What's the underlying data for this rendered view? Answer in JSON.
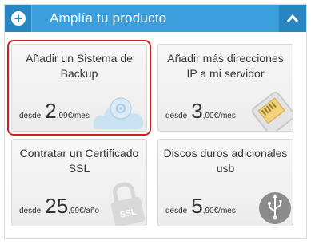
{
  "header": {
    "title": "Amplía tu producto",
    "expand_icon": "plus-circle-icon",
    "collapse_icon": "chevron-up-icon"
  },
  "colors": {
    "header_bg": "#3b9fdc",
    "header_dark": "#2a86c1",
    "selected_outline": "#cf1f1f"
  },
  "cards": [
    {
      "title_line1": "Añadir un Sistema de",
      "title_line2": "Backup",
      "from": "desde",
      "price_int": "2",
      "price_dec": ",99",
      "unit": " €/mes",
      "icon": "cloud-backup-icon",
      "selected": true
    },
    {
      "title_line1": "Añadir más direcciones",
      "title_line2": "IP a mi servidor",
      "from": "desde",
      "price_int": "3",
      "price_dec": ",00",
      "unit": " €/mes",
      "icon": "ethernet-port-icon",
      "selected": false
    },
    {
      "title_line1": "Contratar un Certificado",
      "title_line2": "SSL",
      "from": "desde",
      "price_int": "25",
      "price_dec": ",99",
      "unit": " €/año",
      "icon": "ssl-lock-icon",
      "icon_text": "SSL",
      "selected": false
    },
    {
      "title_line1": "Discos duros adicionales",
      "title_line2": "usb",
      "from": "desde",
      "price_int": "5",
      "price_dec": ",90",
      "unit": " €/mes",
      "icon": "usb-icon",
      "selected": false
    }
  ]
}
